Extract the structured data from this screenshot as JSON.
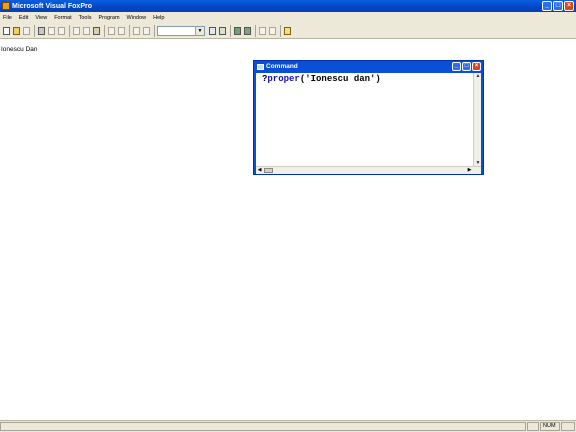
{
  "app": {
    "title": "Microsoft Visual FoxPro"
  },
  "menu": [
    "File",
    "Edit",
    "View",
    "Format",
    "Tools",
    "Program",
    "Window",
    "Help"
  ],
  "toolbar": {
    "icons": [
      "new-icon",
      "open-icon",
      "save-icon",
      "print-icon",
      "print-preview-icon",
      "spelling-icon",
      "cut-icon",
      "copy-icon",
      "paste-icon",
      "undo-icon",
      "redo-icon",
      "run-icon",
      "modify-form-icon",
      "database-icon",
      "command-window-icon",
      "data-session-icon",
      "form-designer-icon",
      "report-designer-icon",
      "form-wizard-icon",
      "report-wizard-icon",
      "help-icon"
    ],
    "combo_value": ""
  },
  "output": {
    "text": "Ionescu Dan"
  },
  "command_window": {
    "title": "Command",
    "prefix": "?",
    "function": "proper",
    "args": "('Ionescu dan')"
  },
  "status": {
    "num": "NUM"
  }
}
